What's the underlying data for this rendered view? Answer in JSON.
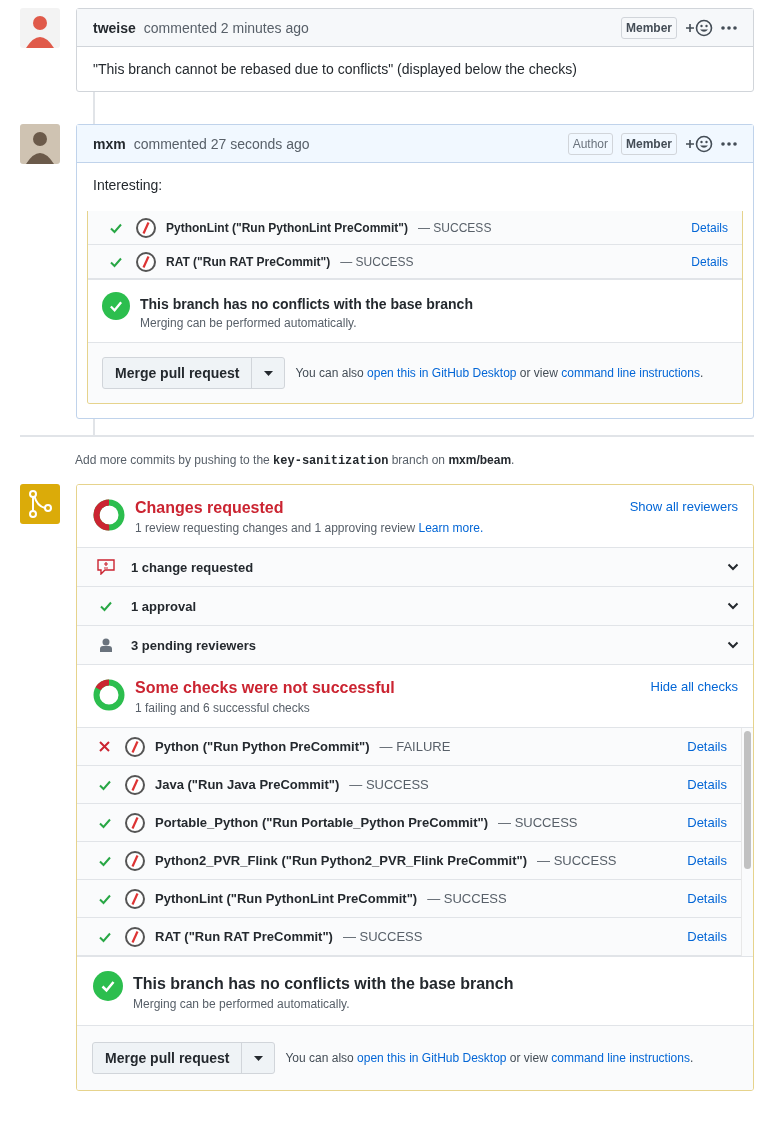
{
  "comments": [
    {
      "author": "tweise",
      "action": "commented 2 minutes ago",
      "own": false,
      "badges": [
        "Member"
      ],
      "body": "\"This branch cannot be rebased due to conflicts\" (displayed below the checks)"
    },
    {
      "author": "mxm",
      "action": "commented 27 seconds ago",
      "own": true,
      "badges": [
        "Author",
        "Member"
      ],
      "body": "Interesting:",
      "screenshot": {
        "checks": [
          {
            "failed": false,
            "name": "PythonLint (\"Run PythonLint PreCommit\")",
            "result": "— SUCCESS",
            "link": "Details"
          },
          {
            "failed": false,
            "name": "RAT (\"Run RAT PreCommit\")",
            "result": "— SUCCESS",
            "link": "Details"
          }
        ],
        "merge_status": {
          "title": "This branch has no conflicts with the base branch",
          "subtitle": "Merging can be performed automatically."
        },
        "merge_button": "Merge pull request",
        "alt_before": "You can also",
        "alt_link1": "open this in GitHub Desktop",
        "alt_middle": "or view",
        "alt_link2": "command line instructions",
        "alt_after": "."
      }
    }
  ],
  "push_note": {
    "before": "Add more commits by pushing to the",
    "branch": "key-sanitization",
    "middle": "branch on",
    "repo": "mxm/beam",
    "after": "."
  },
  "merge_box": {
    "reviews": {
      "title": "Changes requested",
      "subtitle": "1 review requesting changes and 1 approving review",
      "link": "Learn more.",
      "toggle": "Show all reviewers",
      "rows": [
        {
          "kind": "changes",
          "label": "1 change requested"
        },
        {
          "kind": "approval",
          "label": "1 approval"
        },
        {
          "kind": "pending",
          "label": "3 pending reviewers"
        }
      ]
    },
    "checks": {
      "title": "Some checks were not successful",
      "subtitle": "1 failing and 6 successful checks",
      "toggle": "Hide all checks",
      "rows": [
        {
          "failed": true,
          "name": "Python (\"Run Python PreCommit\")",
          "result": "— FAILURE",
          "link": "Details"
        },
        {
          "failed": false,
          "name": "Java (\"Run Java PreCommit\")",
          "result": "— SUCCESS",
          "link": "Details"
        },
        {
          "failed": false,
          "name": "Portable_Python (\"Run Portable_Python PreCommit\")",
          "result": "— SUCCESS",
          "link": "Details"
        },
        {
          "failed": false,
          "name": "Python2_PVR_Flink (\"Run Python2_PVR_Flink PreCommit\")",
          "result": "— SUCCESS",
          "link": "Details"
        },
        {
          "failed": false,
          "name": "PythonLint (\"Run PythonLint PreCommit\")",
          "result": "— SUCCESS",
          "link": "Details"
        },
        {
          "failed": false,
          "name": "RAT (\"Run RAT PreCommit\")",
          "result": "— SUCCESS",
          "link": "Details"
        }
      ]
    },
    "merge_status": {
      "title": "This branch has no conflicts with the base branch",
      "subtitle": "Merging can be performed automatically."
    },
    "merge_button": "Merge pull request",
    "alt_before": "You can also",
    "alt_link1": "open this in GitHub Desktop",
    "alt_middle": "or view",
    "alt_link2": "command line instructions",
    "alt_after": "."
  }
}
